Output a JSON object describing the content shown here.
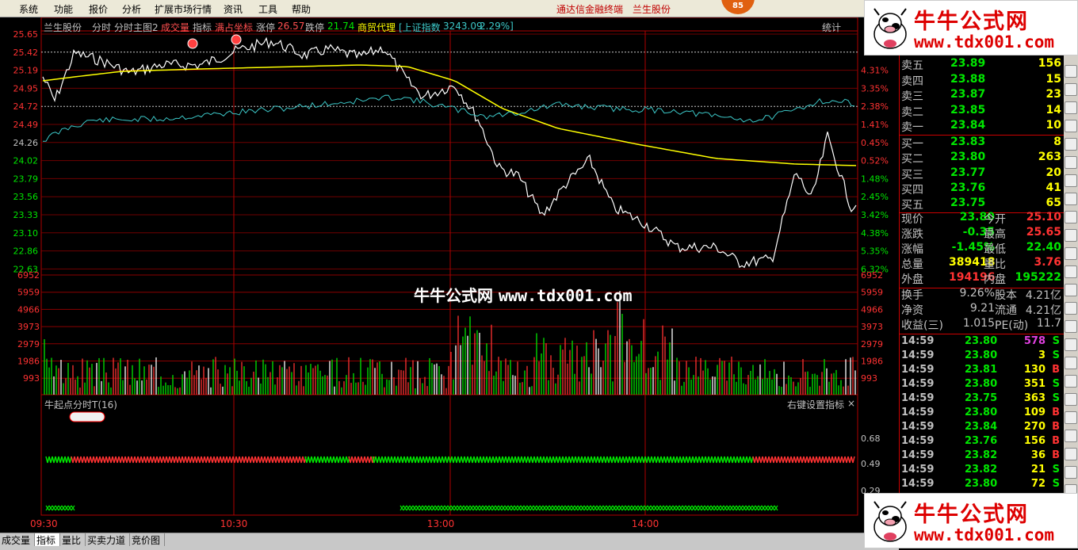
{
  "menu": {
    "items": [
      "系统",
      "功能",
      "报价",
      "分析",
      "扩展市场行情",
      "资讯",
      "工具",
      "帮助"
    ],
    "broker": "通达信金融终端",
    "stock": "兰生股份",
    "badge": "85"
  },
  "header": {
    "stock": "兰生股份",
    "t1": "分时",
    "t2": "分时主图2",
    "t3": "成交量",
    "t4": "指标",
    "t5": "满占坐标",
    "zt_label": "涨停",
    "zt": "26.57",
    "dt_label": "跌停",
    "dt": "21.74",
    "sector": "商贸代理",
    "index": "[上证指数",
    "index_val": "3243.09",
    "index_pct": "2.29%]",
    "stats": "统计"
  },
  "price_axis": [
    "25.65",
    "25.42",
    "25.19",
    "24.95",
    "24.72",
    "24.49",
    "24.26",
    "24.02",
    "23.79",
    "23.56",
    "23.33",
    "23.10",
    "22.86",
    "22.63"
  ],
  "pct_axis_right": [
    "4.31%",
    "3.35%",
    "2.38%",
    "1.41%",
    "0.45%",
    "0.52%",
    "1.48%",
    "2.45%",
    "3.42%",
    "4.38%",
    "5.35%",
    "6.32%"
  ],
  "vol_axis": [
    "6952",
    "5959",
    "4966",
    "3973",
    "2979",
    "1986",
    "993"
  ],
  "sub_axis": [
    "0.68",
    "0.49",
    "0.29"
  ],
  "sub": {
    "name": "牛起点分时T(16)",
    "hint": "右键设置指标",
    "close": "×"
  },
  "time_axis": [
    "09:30",
    "10:30",
    "13:00",
    "14:00"
  ],
  "watermark": {
    "cn": "牛牛公式网",
    "url": "www.tdx001.com"
  },
  "logo": {
    "cn": "牛牛公式网",
    "url": "www.tdx001.com"
  },
  "quote": {
    "sells": [
      {
        "label": "卖五",
        "price": "23.89",
        "vol": "156"
      },
      {
        "label": "卖四",
        "price": "23.88",
        "vol": "15"
      },
      {
        "label": "卖三",
        "price": "23.87",
        "vol": "23"
      },
      {
        "label": "卖二",
        "price": "23.85",
        "vol": "14"
      },
      {
        "label": "卖一",
        "price": "23.84",
        "vol": "10"
      }
    ],
    "buys": [
      {
        "label": "买一",
        "price": "23.83",
        "vol": "8"
      },
      {
        "label": "买二",
        "price": "23.80",
        "vol": "263"
      },
      {
        "label": "买三",
        "price": "23.77",
        "vol": "20"
      },
      {
        "label": "买四",
        "price": "23.76",
        "vol": "41"
      },
      {
        "label": "买五",
        "price": "23.75",
        "vol": "65"
      }
    ],
    "info": [
      {
        "l1": "现价",
        "v1": "23.80",
        "l2": "今开",
        "v2": "25.10"
      },
      {
        "l1": "涨跌",
        "v1": "-0.35",
        "l2": "最高",
        "v2": "25.65"
      },
      {
        "l1": "涨幅",
        "v1": "-1.45%",
        "l2": "最低",
        "v2": "22.40"
      },
      {
        "l1": "总量",
        "v1": "389418",
        "l2": "量比",
        "v2": "3.76"
      },
      {
        "l1": "外盘",
        "v1": "194196",
        "l2": "内盘",
        "v2": "195222"
      }
    ],
    "info2": [
      {
        "l1": "换手",
        "v1": "9.26%",
        "l2": "股本",
        "v2": "4.21亿"
      },
      {
        "l1": "净资",
        "v1": "9.21",
        "l2": "流通",
        "v2": "4.21亿"
      },
      {
        "l1": "收益(三)",
        "v1": "1.015",
        "l2": "PE(动)",
        "v2": "11.7"
      }
    ],
    "trades": [
      {
        "t": "14:59",
        "p": "23.80",
        "v": "578",
        "s": "S"
      },
      {
        "t": "14:59",
        "p": "23.80",
        "v": "3",
        "s": "S"
      },
      {
        "t": "14:59",
        "p": "23.81",
        "v": "130",
        "s": "B"
      },
      {
        "t": "14:59",
        "p": "23.80",
        "v": "351",
        "s": "S"
      },
      {
        "t": "14:59",
        "p": "23.75",
        "v": "363",
        "s": "S"
      },
      {
        "t": "14:59",
        "p": "23.80",
        "v": "109",
        "s": "B"
      },
      {
        "t": "14:59",
        "p": "23.84",
        "v": "270",
        "s": "B"
      },
      {
        "t": "14:59",
        "p": "23.76",
        "v": "156",
        "s": "B"
      },
      {
        "t": "14:59",
        "p": "23.82",
        "v": "36",
        "s": "B"
      },
      {
        "t": "14:59",
        "p": "23.82",
        "v": "21",
        "s": "S"
      },
      {
        "t": "14:59",
        "p": "23.80",
        "v": "72",
        "s": "S"
      }
    ]
  },
  "bottom_tabs": [
    "成交量",
    "指标",
    "量比",
    "买卖力道",
    "竞价图"
  ],
  "colors": {
    "up": "#ff3232",
    "down": "#00e600",
    "price_line": "#ffffff",
    "avg_line": "#ffff00",
    "index_line": "#3cc8c8",
    "grid": "#8b0000"
  }
}
